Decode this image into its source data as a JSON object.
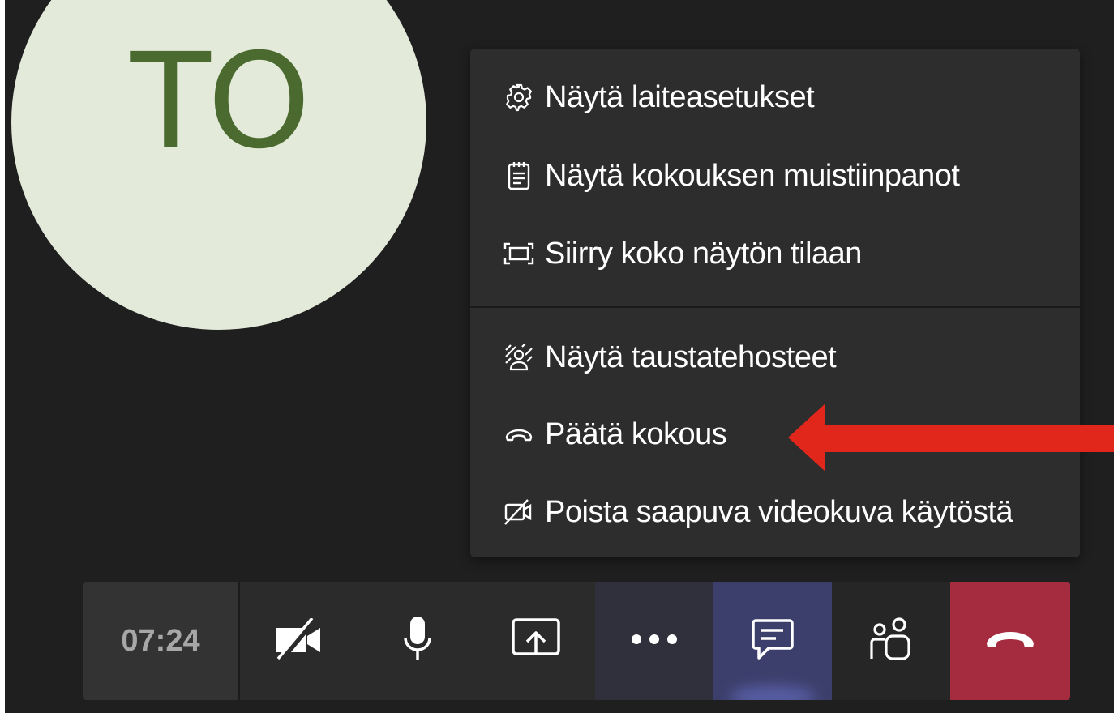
{
  "avatar": {
    "initials": "TO",
    "bg_color": "#e3ead9",
    "text_color": "#4b6a30"
  },
  "menu": {
    "items": [
      {
        "icon": "gear-icon",
        "label": "Näytä laiteasetukset"
      },
      {
        "icon": "notepad-icon",
        "label": "Näytä kokouksen muistiinpanot"
      },
      {
        "icon": "fullscreen-icon",
        "label": "Siirry koko näytön tilaan"
      },
      {
        "icon": "background-effects-icon",
        "label": "Näytä taustatehosteet"
      },
      {
        "icon": "hang-up-icon",
        "label": "Päätä kokous"
      },
      {
        "icon": "video-off-icon",
        "label": "Poista saapuva videokuva käytöstä"
      }
    ]
  },
  "annotation": {
    "type": "red-arrow",
    "color": "#e1261c",
    "points_to": "Päätä kokous"
  },
  "toolbar": {
    "timer": "07:24",
    "buttons": [
      {
        "icon": "camera-off-icon"
      },
      {
        "icon": "microphone-icon"
      },
      {
        "icon": "share-screen-icon"
      },
      {
        "icon": "more-options-icon"
      },
      {
        "icon": "chat-icon"
      },
      {
        "icon": "participants-icon"
      },
      {
        "icon": "hang-up-icon"
      }
    ],
    "hangup_color": "#a52c3f",
    "active_color": "#3c3f6b"
  }
}
